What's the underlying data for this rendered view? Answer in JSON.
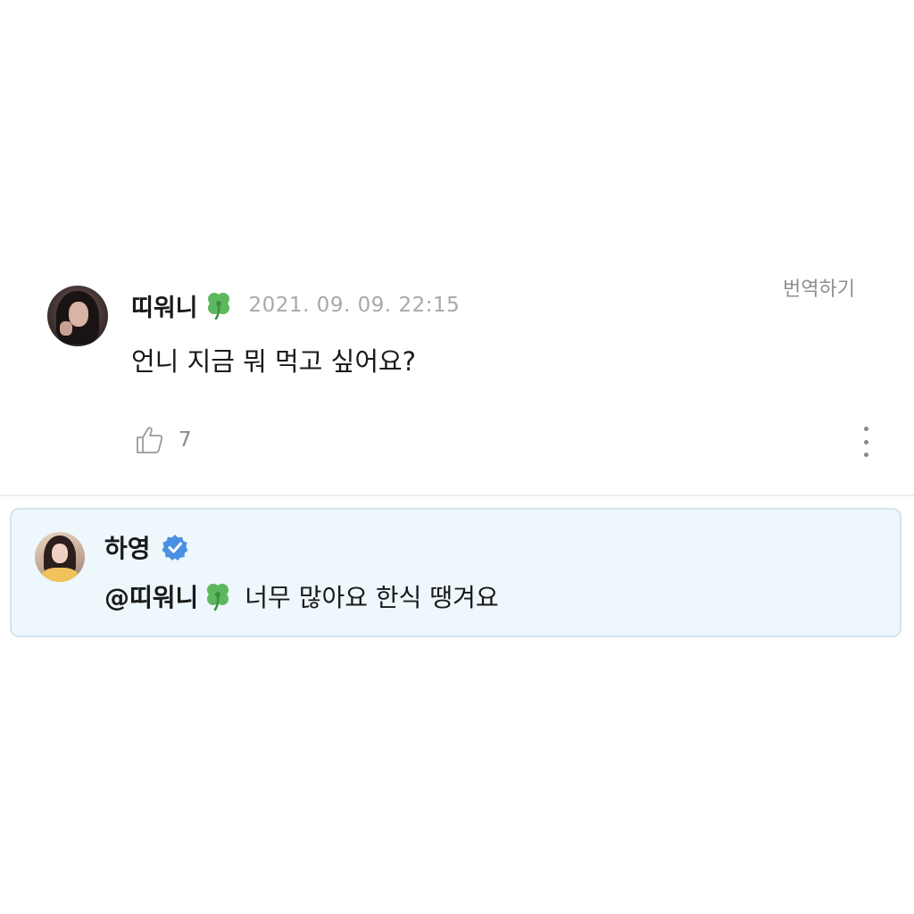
{
  "comment": {
    "author": "띠워니",
    "author_emoji": "clover-icon",
    "timestamp": "2021. 09. 09. 22:15",
    "translate_label": "번역하기",
    "text": "언니 지금 뭐 먹고 싶어요?",
    "like_count": "7"
  },
  "reply": {
    "author": "하영",
    "verified": true,
    "mention": "@띠워니",
    "text": "너무 많아요 한식 땡겨요"
  },
  "colors": {
    "reply_background": "#edf7fc",
    "reply_border": "#d3e6ee",
    "verified_badge": "#4a90e2",
    "clover": "#4caf50"
  }
}
